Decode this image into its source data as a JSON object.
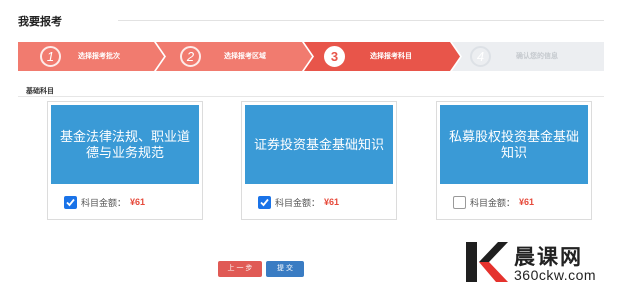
{
  "page": {
    "title": "我要报考"
  },
  "steps": [
    {
      "number": "1",
      "label": "选择报考批次",
      "state": "done"
    },
    {
      "number": "2",
      "label": "选择报考区域",
      "state": "done"
    },
    {
      "number": "3",
      "label": "选择报考科目",
      "state": "active"
    },
    {
      "number": "4",
      "label": "确认您的信息",
      "state": "inactive"
    }
  ],
  "section": {
    "label": "基础科目"
  },
  "subjects": [
    {
      "name": "基金法律法规、职业道德与业务规范",
      "fee_label": "科目金额：",
      "fee": "¥61",
      "checked": true
    },
    {
      "name": "证券投资基金基础知识",
      "fee_label": "科目金额：",
      "fee": "¥61",
      "checked": true
    },
    {
      "name": "私募股权投资基金基础知识",
      "fee_label": "科目金额：",
      "fee": "¥61",
      "checked": false
    }
  ],
  "buttons": {
    "prev": "上 一 步",
    "submit": "提   交"
  },
  "watermark": {
    "name": "晨课网",
    "domain": "360ckw.com"
  },
  "colors": {
    "step_done": "#f17b6f",
    "step_active": "#e8554a",
    "step_inactive": "#eceef1",
    "banner": "#3a9ad6",
    "checkbox": "#1a73e8",
    "fee": "#e64a3b",
    "btn_prev": "#e05a55",
    "btn_submit": "#3a7cc3"
  }
}
